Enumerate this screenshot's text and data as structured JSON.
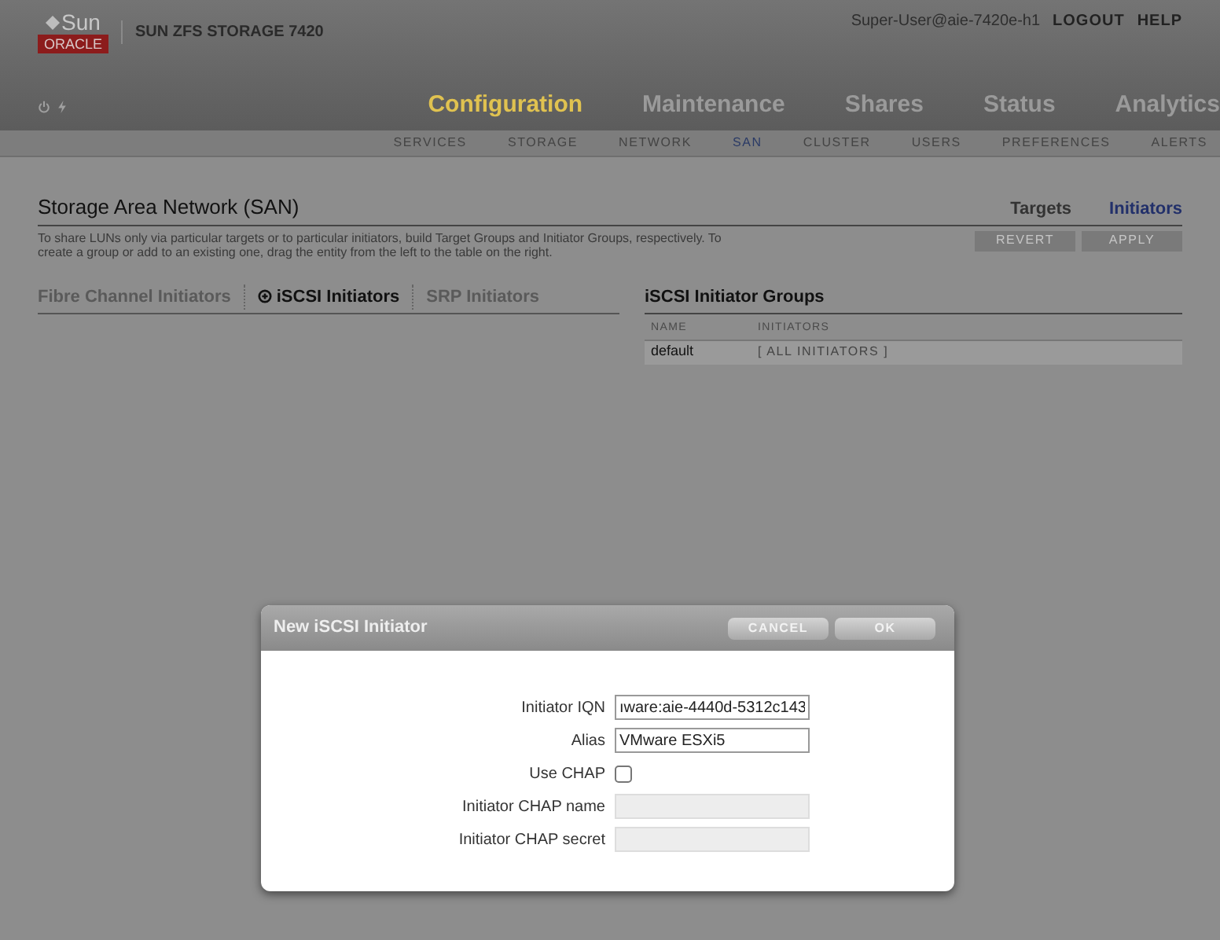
{
  "brand": {
    "logo_top": "Sun",
    "logo_bottom": "ORACLE",
    "product": "SUN ZFS STORAGE 7420"
  },
  "user": {
    "name": "Super-User@aie-7420e-h1",
    "links": [
      "LOGOUT",
      "HELP"
    ]
  },
  "main_tabs": [
    {
      "label": "Configuration",
      "selected": true
    },
    {
      "label": "Maintenance",
      "selected": false
    },
    {
      "label": "Shares",
      "selected": false
    },
    {
      "label": "Status",
      "selected": false
    },
    {
      "label": "Analytics",
      "selected": false
    }
  ],
  "sub_tabs": [
    {
      "label": "SERVICES",
      "selected": false
    },
    {
      "label": "STORAGE",
      "selected": false
    },
    {
      "label": "NETWORK",
      "selected": false
    },
    {
      "label": "SAN",
      "selected": true
    },
    {
      "label": "CLUSTER",
      "selected": false
    },
    {
      "label": "USERS",
      "selected": false
    },
    {
      "label": "PREFERENCES",
      "selected": false
    },
    {
      "label": "ALERTS",
      "selected": false
    }
  ],
  "page": {
    "title": "Storage Area Network (SAN)",
    "description": "To share LUNs only via particular targets or to particular initiators, build Target Groups and Initiator Groups, respectively. To create a group or add to an existing one, drag the entity from the left to the table on the right.",
    "views": [
      {
        "label": "Targets",
        "selected": false
      },
      {
        "label": "Initiators",
        "selected": true
      }
    ],
    "actions": [
      {
        "label": "REVERT",
        "disabled": true
      },
      {
        "label": "APPLY",
        "disabled": true
      }
    ]
  },
  "initiator_tabs": [
    {
      "label": "Fibre Channel Initiators",
      "selected": false,
      "add": false
    },
    {
      "label": "iSCSI Initiators",
      "selected": true,
      "add": true
    },
    {
      "label": "SRP Initiators",
      "selected": false,
      "add": false
    }
  ],
  "groups": {
    "title": "iSCSI Initiator Groups",
    "columns": [
      "NAME",
      "INITIATORS"
    ],
    "rows": [
      [
        "default",
        "[ ALL INITIATORS ]"
      ]
    ]
  },
  "dialog": {
    "title": "New iSCSI Initiator",
    "buttons": [
      "CANCEL",
      "OK"
    ],
    "fields": [
      {
        "kind": "text",
        "label": "Initiator IQN",
        "value": "ıware:aie-4440d-5312c143",
        "disabled": false
      },
      {
        "kind": "text",
        "label": "Alias",
        "value": "VMware ESXi5",
        "disabled": false
      },
      {
        "kind": "checkbox",
        "label": "Use CHAP",
        "checked": false
      },
      {
        "kind": "text",
        "label": "Initiator CHAP name",
        "disabled": true
      },
      {
        "kind": "text",
        "label": "Initiator CHAP secret",
        "disabled": true
      }
    ]
  }
}
